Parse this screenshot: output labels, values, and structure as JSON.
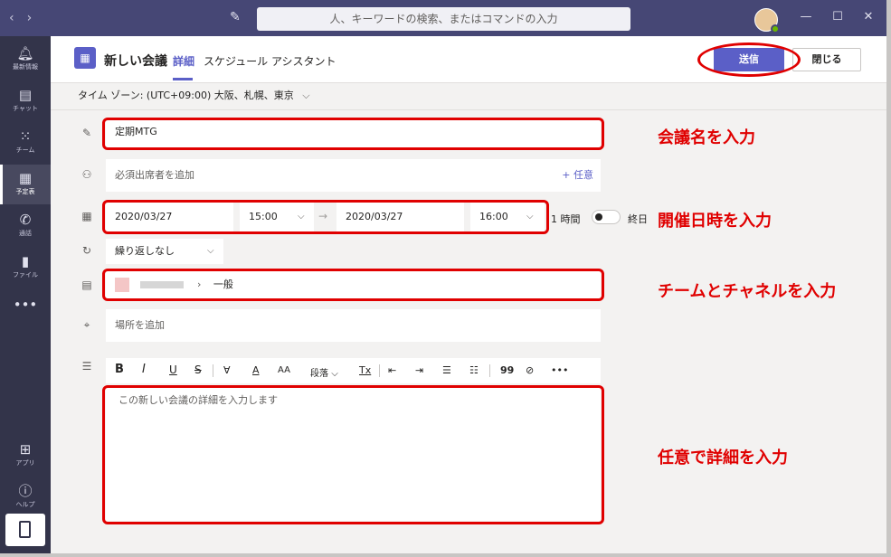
{
  "titlebar": {
    "search_placeholder": "人、キーワードの検索、またはコマンドの入力",
    "nav_back": "‹",
    "nav_forward": "›",
    "compose_icon": "compose-icon",
    "minimize": "—",
    "maximize": "☐",
    "close": "✕"
  },
  "rail": {
    "items": [
      {
        "label": "最新情報",
        "icon": "bell-icon"
      },
      {
        "label": "チャット",
        "icon": "chat-icon"
      },
      {
        "label": "チーム",
        "icon": "teams-icon"
      },
      {
        "label": "予定表",
        "icon": "calendar-icon"
      },
      {
        "label": "通話",
        "icon": "phone-icon"
      },
      {
        "label": "ファイル",
        "icon": "file-icon"
      },
      {
        "label": "•••",
        "icon": "more-icon"
      }
    ],
    "apps_label": "アプリ",
    "help_label": "ヘルプ"
  },
  "header": {
    "title": "新しい会議",
    "tabs": [
      "詳細",
      "スケジュール アシスタント"
    ],
    "send_label": "送信",
    "close_label": "閉じる"
  },
  "timezone": "タイム ゾーン: (UTC+09:00) 大阪、札幌、東京",
  "form": {
    "title_value": "定期MTG",
    "attendees_placeholder": "必須出席者を追加",
    "optional_label": "+ 任意",
    "start_date": "2020/03/27",
    "start_time": "15:00",
    "end_date": "2020/03/27",
    "end_time": "16:00",
    "duration": "1 時間",
    "allday_label": "終日",
    "repeat_value": "繰り返しなし",
    "channel_value": "一般",
    "location_placeholder": "場所を追加",
    "details_placeholder": "この新しい会議の詳細を入力します",
    "toolbar": {
      "bold": "B",
      "italic": "I",
      "underline": "U",
      "strike": "S",
      "highlight": "∀",
      "fontcolor": "A",
      "fontsize": "AA",
      "paragraph": "段落",
      "clear": "Tx",
      "outdent": "⇤",
      "indent": "⇥",
      "bullets": "☰",
      "numbered": "☷",
      "quote": "99",
      "link": "⊘",
      "more": "•••"
    }
  },
  "annotations": {
    "title_note": "会議名を入力",
    "datetime_note": "開催日時を入力",
    "channel_note": "チームとチャネルを入力",
    "details_note": "任意で詳細を入力"
  },
  "colors": {
    "titlebar": "#464775",
    "rail": "#33344a",
    "accent": "#5b5fc7",
    "annotation_red": "#e00000"
  }
}
